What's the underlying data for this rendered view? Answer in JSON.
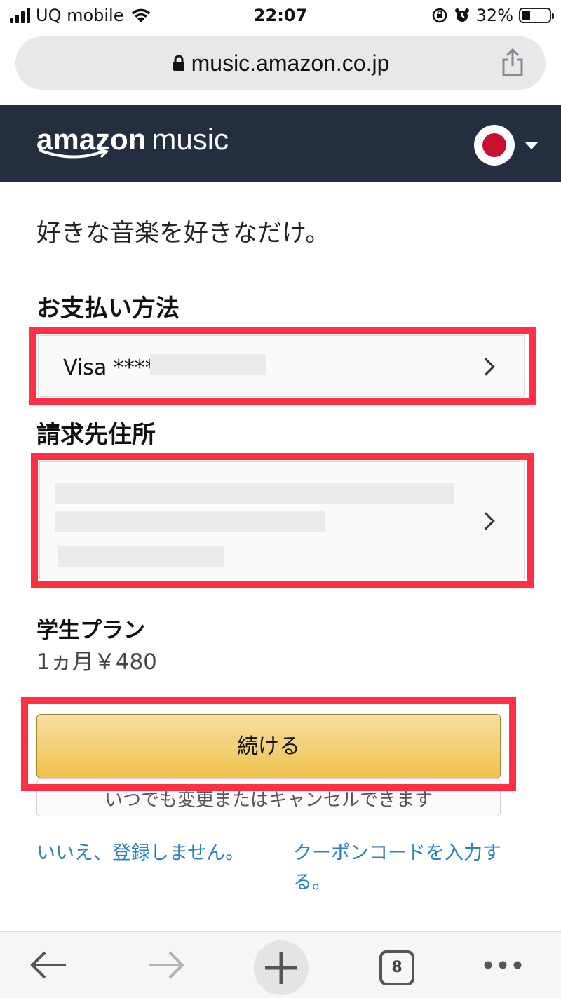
{
  "status_bar": {
    "carrier": "UQ mobile",
    "time": "22:07",
    "battery_percent": "32%"
  },
  "browser": {
    "url": "music.amazon.co.jp",
    "tab_count": "8"
  },
  "header": {
    "logo_word1": "amazon",
    "logo_word2": "music"
  },
  "main": {
    "tagline": "好きな音楽を好きなだけ。",
    "payment_title": "お支払い方法",
    "payment_value": "Visa ****",
    "billing_title": "請求先住所",
    "plan_title": "学生プラン",
    "plan_price": "1ヵ月￥480",
    "continue_label": "続ける",
    "cancel_note": "いつでも変更またはキャンセルできます",
    "decline_link": "いいえ、登録しません。",
    "coupon_link": "クーポンコードを入力する。"
  },
  "colors": {
    "header_bg": "#232f3e",
    "highlight": "#ff2f45",
    "link": "#2a7fc7",
    "button_gold": "#f0c14b"
  }
}
